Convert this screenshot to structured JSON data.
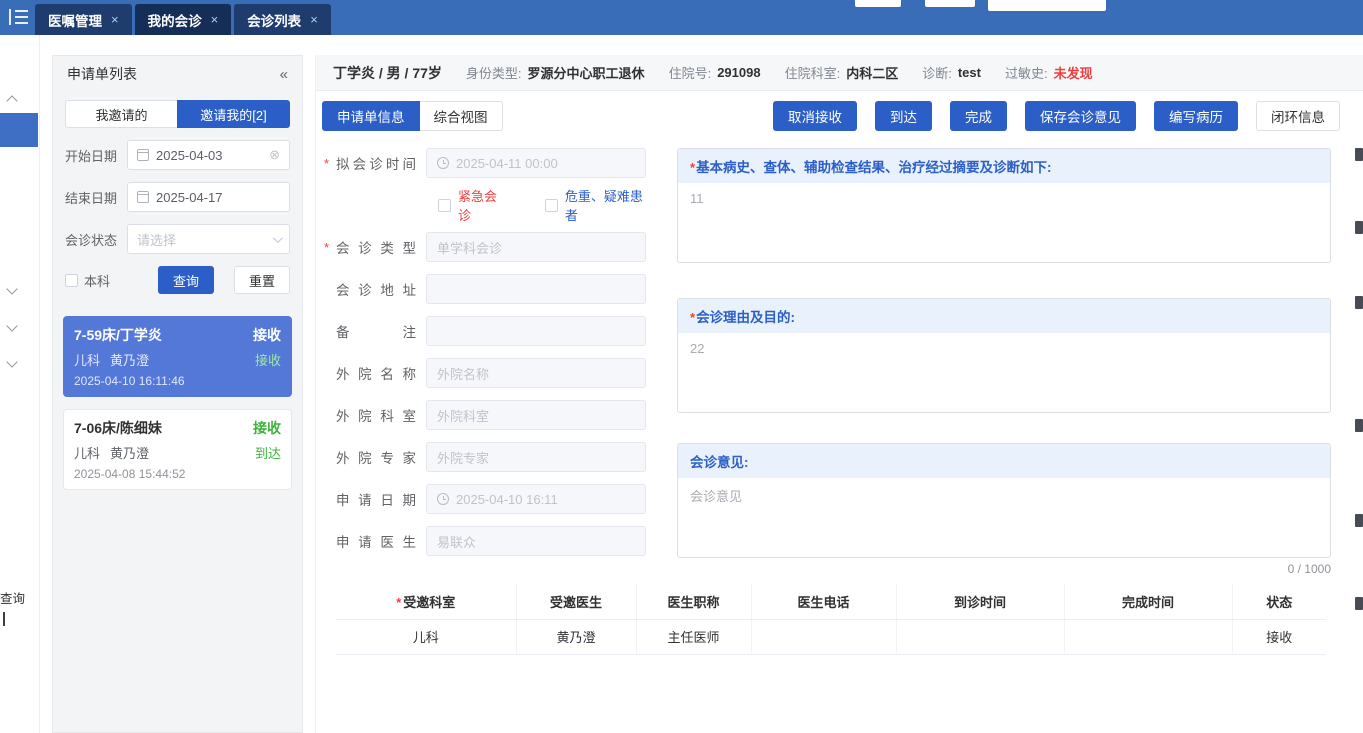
{
  "required_mark": "*",
  "topbar": {
    "tabs": [
      {
        "label": "医嘱管理",
        "close_icon": "×"
      },
      {
        "label": "我的会诊",
        "close_icon": "×"
      },
      {
        "label": "会诊列表",
        "close_icon": "×"
      }
    ]
  },
  "left_rail": {
    "partial_text": "查询"
  },
  "sidebar": {
    "title": "申请单列表",
    "collapse_icon": "«",
    "toggles": [
      {
        "label": "我邀请的"
      },
      {
        "label": "邀请我的[2]"
      }
    ],
    "filters": {
      "start_label": "开始日期",
      "start_value": "2025-04-03",
      "clear_icon": "⊗",
      "end_label": "结束日期",
      "end_value": "2025-04-17",
      "status_label": "会诊状态",
      "status_placeholder": "请选择",
      "dept_checkbox": "本科",
      "search": "查询",
      "reset": "重置"
    },
    "cards": [
      {
        "bed": "7-59床/丁学炎",
        "status": "接收",
        "dept": "儿科",
        "doctor": "黄乃澄",
        "sub_status": "接收",
        "time": "2025-04-10 16:11:46"
      },
      {
        "bed": "7-06床/陈细妹",
        "status": "接收",
        "dept": "儿科",
        "doctor": "黄乃澄",
        "sub_status": "到达",
        "time": "2025-04-08 15:44:52"
      }
    ]
  },
  "patient": {
    "name": "丁学炎 / 男 / 77岁",
    "identity_label": "身份类型:",
    "identity_value": "罗源分中心职工退休",
    "admission_label": "住院号:",
    "admission_value": "291098",
    "ward_label": "住院科室:",
    "ward_value": "内科二区",
    "diagnosis_label": "诊断:",
    "diagnosis_value": "test",
    "allergy_label": "过敏史:",
    "allergy_value": "未发现"
  },
  "toolbar": {
    "tab_request_info": "申请单信息",
    "tab_overview": "综合视图",
    "cancel_receive": "取消接收",
    "arrive": "到达",
    "complete": "完成",
    "save_opinion": "保存会诊意见",
    "write_record": "编写病历",
    "loop_info": "闭环信息"
  },
  "form": {
    "consult_time_label": "拟会诊时间",
    "consult_time_value": "2025-04-11 00:00",
    "urgent_label": "紧急会诊",
    "critical_label": "危重、疑难患者",
    "type_label": "会诊类型",
    "type_value": "单学科会诊",
    "address_label": "会诊地址",
    "address_value": "",
    "remark_label": "备注",
    "remark_value": "",
    "ext_name_label": "外院名称",
    "ext_name_placeholder": "外院名称",
    "ext_dept_label": "外院科室",
    "ext_dept_placeholder": "外院科室",
    "ext_expert_label": "外院专家",
    "ext_expert_placeholder": "外院专家",
    "apply_date_label": "申请日期",
    "apply_date_value": "2025-04-10 16:11",
    "apply_doctor_label": "申请医生",
    "apply_doctor_value": "易联众"
  },
  "sections": {
    "history_title": "基本病史、查体、辅助检查结果、治疗经过摘要及诊断如下:",
    "history_value": "11",
    "reason_title": "会诊理由及目的:",
    "reason_value": "22",
    "opinion_title": "会诊意见:",
    "opinion_placeholder": "会诊意见",
    "opinion_counter": "0 / 1000"
  },
  "table": {
    "headers": [
      "受邀科室",
      "受邀医生",
      "医生职称",
      "医生电话",
      "到诊时间",
      "完成时间",
      "状态"
    ],
    "rows": [
      [
        "儿科",
        "黄乃澄",
        "主任医师",
        "",
        "",
        "",
        "接收"
      ]
    ]
  }
}
